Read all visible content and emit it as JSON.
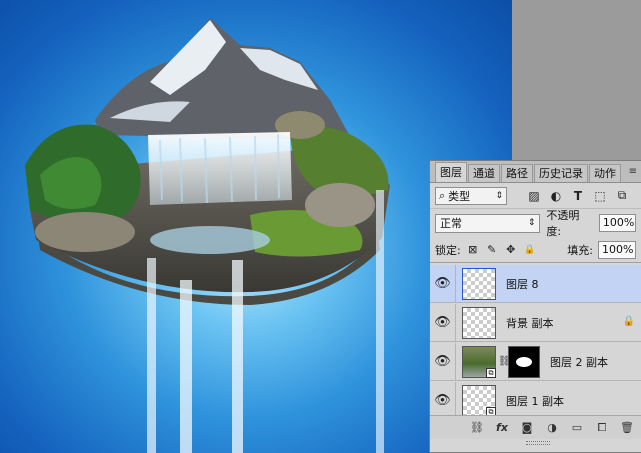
{
  "panel": {
    "tabs": [
      {
        "label": "图层"
      },
      {
        "label": "通道"
      },
      {
        "label": "路径"
      },
      {
        "label": "历史记录"
      },
      {
        "label": "动作"
      }
    ],
    "menu_glyph": "≡",
    "filter": {
      "kind_icon": "⌕",
      "kind_label": "类型",
      "caret": "⇕",
      "icons": [
        {
          "name": "pixel-filter-icon",
          "glyph": "▨"
        },
        {
          "name": "adjustment-filter-icon",
          "glyph": "◐"
        },
        {
          "name": "type-filter-icon",
          "glyph": "T"
        },
        {
          "name": "shape-filter-icon",
          "glyph": "⬚"
        },
        {
          "name": "smart-object-filter-icon",
          "glyph": "⧉"
        }
      ]
    },
    "blend": {
      "mode": "正常",
      "caret": "⇕",
      "opacity_label": "不透明度:",
      "opacity_value": "100%"
    },
    "lock": {
      "label": "锁定:",
      "fill_label": "填充:",
      "fill_value": "100%",
      "icons": [
        {
          "name": "lock-transparent-icon",
          "glyph": "⊠"
        },
        {
          "name": "lock-pixels-icon",
          "glyph": "✎"
        },
        {
          "name": "lock-position-icon",
          "glyph": "✥"
        },
        {
          "name": "lock-all-icon",
          "glyph": "🔒"
        }
      ]
    },
    "layers": [
      {
        "name": "图层 8",
        "eye": "👁"
      },
      {
        "name": "背景 副本",
        "eye": "👁",
        "lock": "🔒"
      },
      {
        "name": "图层 2 副本",
        "eye": "👁",
        "chain": "⛓",
        "badge": "⧉"
      },
      {
        "name": "图层 1 副本",
        "eye": "👁",
        "badge": "⧉"
      }
    ],
    "footer_icons": [
      {
        "name": "link-layers-icon",
        "glyph": "⛓"
      },
      {
        "name": "layer-style-icon",
        "glyph": "fx"
      },
      {
        "name": "add-mask-icon",
        "glyph": "◙"
      },
      {
        "name": "adjustment-layer-icon",
        "glyph": "◑"
      },
      {
        "name": "new-group-icon",
        "glyph": "▭"
      },
      {
        "name": "new-layer-icon",
        "glyph": "⧠"
      },
      {
        "name": "delete-layer-icon",
        "glyph": "🗑"
      }
    ]
  }
}
